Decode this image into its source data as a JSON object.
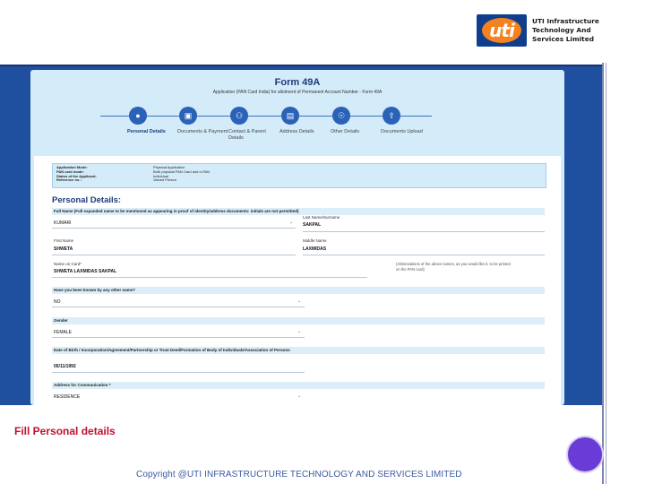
{
  "logo": {
    "mark": "uti",
    "lines": [
      "UTI Infrastructure",
      "Technology And",
      "Services Limited"
    ]
  },
  "form": {
    "title": "Form 49A",
    "subtitle": "Application (PAN Card India) for allotment of Permanent Account Number - Form 49A",
    "steps": [
      {
        "label": "Personal Details",
        "icon": "user-icon"
      },
      {
        "label": "Documents & Payment",
        "icon": "document-icon"
      },
      {
        "label": "Contact & Parent Details",
        "icon": "family-icon"
      },
      {
        "label": "Address Details",
        "icon": "id-card-icon"
      },
      {
        "label": "Other Details",
        "icon": "info-icon"
      },
      {
        "label": "Documents Upload",
        "icon": "upload-icon"
      }
    ],
    "info_labels": [
      "Application Mode:",
      "PAN card mode:",
      "Status of the Applicant:",
      "Reference no.:"
    ],
    "info_values": [
      "Physical Application",
      "Both physical PAN Card and e-PAN",
      "Individual",
      "Valued Person"
    ],
    "section_title": "Personal Details:",
    "full_name_bar": "Full Name (Full expanded name to be mentioned as appearing in proof of identity/address documents: initials are not permitted)",
    "title_value": "KUMARI",
    "last_name_label": "Last Name/Surname",
    "last_name_value": "SAKPAL",
    "first_name_label": "First Name",
    "first_name_value": "SHWETA",
    "middle_name_label": "Middle Name",
    "middle_name_value": "LAXMIDAS",
    "name_on_card_label": "Name on Card*",
    "name_on_card_value": "SHWETA LAXMIDAS SAKPAL",
    "name_note": "(Abbreviations of the above names, as you would like it, to be printed on the PAN card)",
    "known_by_bar": "Have you been known by any other name?",
    "known_by_value": "NO",
    "gender_bar": "Gender",
    "gender_value": "FEMALE",
    "dob_bar": "Date of Birth / Incorporation/Agreement/Partnership or Trust Deed/Formation of Body of Individuals/Association of Persons",
    "dob_value": "05/11/1992",
    "address_bar": "Address for Communication *",
    "address_value": "RESIDENCE"
  },
  "caption": "Fill Personal details",
  "copyright": "Copyright @UTI INFRASTRUCTURE TECHNOLOGY AND SERVICES LIMITED",
  "colors": {
    "brand_blue": "#0f3f8c",
    "brand_orange": "#f58220",
    "caption_red": "#c0102e",
    "accent_purple": "#6a3bd6"
  }
}
